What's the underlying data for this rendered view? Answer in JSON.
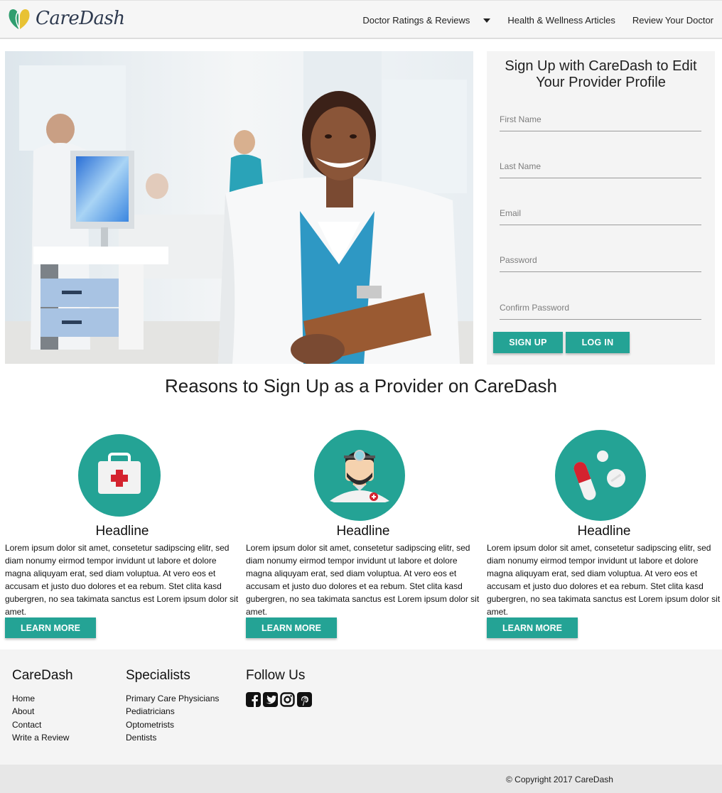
{
  "header": {
    "logo_text": "CareDash",
    "nav": [
      {
        "label": "Doctor Ratings & Reviews"
      },
      {
        "label": "Health & Wellness Articles"
      },
      {
        "label": "Review Your Doctor"
      }
    ]
  },
  "signup": {
    "title": "Sign Up with CareDash to Edit Your Provider Profile",
    "fields": [
      {
        "placeholder": "First Name",
        "value": ""
      },
      {
        "placeholder": "Last Name",
        "value": ""
      },
      {
        "placeholder": "Email",
        "value": ""
      },
      {
        "placeholder": "Password",
        "value": ""
      },
      {
        "placeholder": "Confirm Password",
        "value": ""
      }
    ],
    "signup_label": "SIGN UP",
    "login_label": "LOG IN"
  },
  "reasons": {
    "title": "Reasons to Sign Up as a Provider on CareDash",
    "items": [
      {
        "icon": "medical-kit-icon",
        "headline": "Headline",
        "text": "Lorem ipsum dolor sit amet, consetetur sadipscing elitr, sed diam nonumy eirmod tempor invidunt ut labore et dolore magna aliquyam erat, sed diam voluptua. At vero eos et accusam et justo duo dolores et ea rebum. Stet clita kasd gubergren, no sea takimata sanctus est Lorem ipsum dolor sit amet.",
        "button": "LEARN MORE"
      },
      {
        "icon": "doctor-icon",
        "headline": "Headline",
        "text": "Lorem ipsum dolor sit amet, consetetur sadipscing elitr, sed diam nonumy eirmod tempor invidunt ut labore et dolore magna aliquyam erat, sed diam voluptua. At vero eos et accusam et justo duo dolores et ea rebum. Stet clita kasd gubergren, no sea takimata sanctus est Lorem ipsum dolor sit amet.",
        "button": "LEARN MORE"
      },
      {
        "icon": "pills-icon",
        "headline": "Headline",
        "text": "Lorem ipsum dolor sit amet, consetetur sadipscing elitr, sed diam nonumy eirmod tempor invidunt ut labore et dolore magna aliquyam erat, sed diam voluptua. At vero eos et accusam et justo duo dolores et ea rebum. Stet clita kasd gubergren, no sea takimata sanctus est Lorem ipsum dolor sit amet.",
        "button": "LEARN MORE"
      }
    ]
  },
  "footer": {
    "caredash": {
      "title": "CareDash",
      "links": [
        "Home",
        "About",
        "Contact",
        "Write a Review"
      ]
    },
    "specialists": {
      "title": "Specialists",
      "links": [
        "Primary Care Physicians",
        "Pediatricians",
        "Optometrists",
        "Dentists"
      ]
    },
    "follow": {
      "title": "Follow Us",
      "icons": [
        "facebook-icon",
        "twitter-icon",
        "instagram-icon",
        "pinterest-icon"
      ]
    },
    "copyright": "© Copyright 2017 CareDash"
  },
  "colors": {
    "accent": "#24a395",
    "logo_green": "#3cb371",
    "logo_text": "#2e3a4f"
  }
}
